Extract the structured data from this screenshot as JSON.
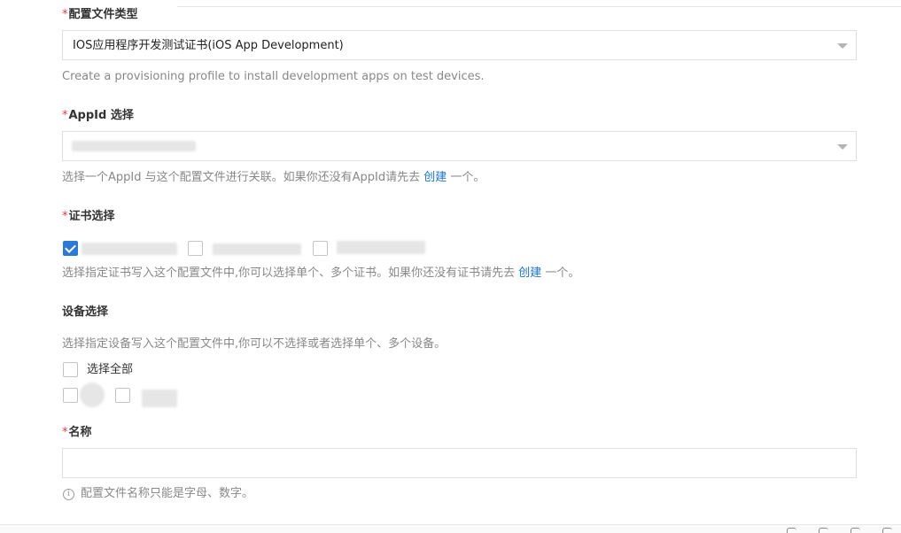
{
  "form": {
    "profile_type": {
      "required_mark": "*",
      "label": "配置文件类型",
      "selected_value": "IOS应用程序开发测试证书(iOS App Development)",
      "help_text": "Create a provisioning profile to install development apps on test devices."
    },
    "appid": {
      "required_mark": "*",
      "label": "AppId 选择",
      "help_prefix": "选择一个AppId 与这个配置文件进行关联。如果你还没有AppId请先去 ",
      "help_link": "创建",
      "help_suffix": " 一个。"
    },
    "certificate": {
      "required_mark": "*",
      "label": "证书选择",
      "options": [
        {
          "checked": true
        },
        {
          "checked": false
        },
        {
          "checked": false
        }
      ],
      "help_prefix": "选择指定证书写入这个配置文件中,你可以选择单个、多个证书。如果你还没有证书请先去 ",
      "help_link": "创建",
      "help_suffix": " 一个。"
    },
    "device": {
      "label": "设备选择",
      "help_text": "选择指定设备写入这个配置文件中,你可以不选择或者选择单个、多个设备。",
      "select_all_label": "选择全部",
      "options": [
        {
          "checked": false
        },
        {
          "checked": false
        }
      ]
    },
    "name": {
      "required_mark": "*",
      "label": "名称",
      "value": "",
      "hint": "配置文件名称只能是字母、数字。",
      "info_icon_glyph": "i"
    }
  },
  "colors": {
    "required": "#e4393c",
    "link": "#1a73c9",
    "checkbox_checked": "#2c7ad6"
  },
  "icons": {
    "dropdown": "caret-down-icon",
    "info": "info-icon"
  }
}
